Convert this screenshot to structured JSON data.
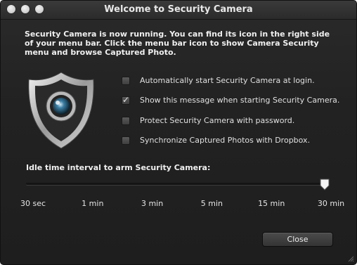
{
  "window": {
    "title": "Welcome to Security Camera"
  },
  "intro": "Security Camera is now running. You can find its icon in the right side of your menu bar. Click the menu bar icon to show Camera Security menu and browse Captured Photo.",
  "options": [
    {
      "label": "Automatically start Security Camera at login.",
      "checked": false
    },
    {
      "label": "Show this message when starting Security Camera.",
      "checked": true
    },
    {
      "label": "Protect Security Camera with password.",
      "checked": false
    },
    {
      "label": "Synchronize Captured Photos with Dropbox.",
      "checked": false
    }
  ],
  "idle": {
    "label": "Idle time interval to arm Security Camera:",
    "ticks": [
      "30 sec",
      "1 min",
      "3 min",
      "5 min",
      "15 min",
      "30 min"
    ],
    "selected_index": 5
  },
  "buttons": {
    "close": "Close"
  },
  "icons": {
    "app_icon": "shield-camera-icon"
  }
}
